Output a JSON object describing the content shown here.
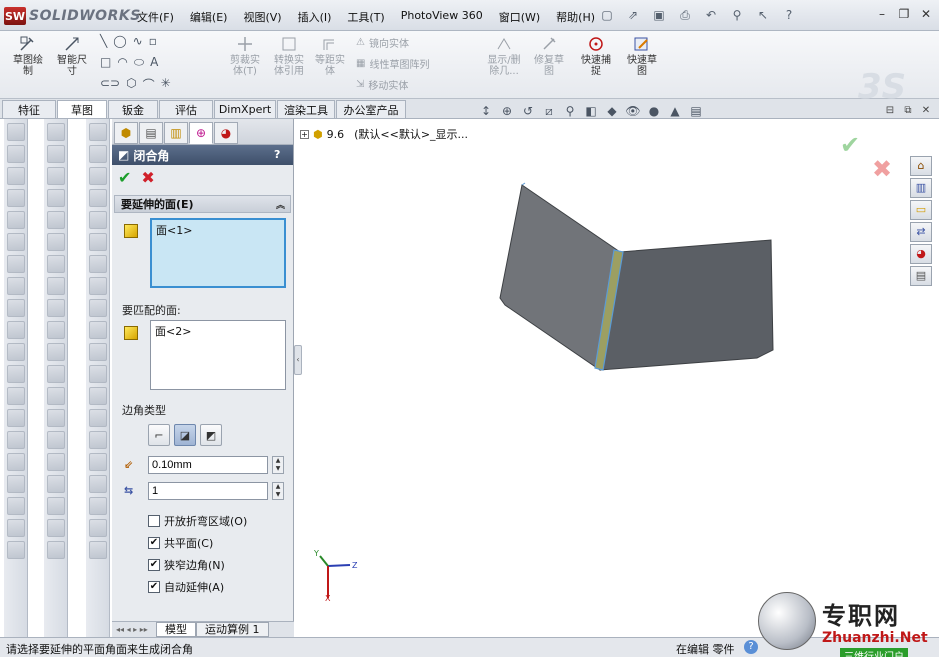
{
  "app": {
    "name": "SOLIDWORKS"
  },
  "menu": [
    "文件(F)",
    "编辑(E)",
    "视图(V)",
    "插入(I)",
    "工具(T)",
    "PhotoView 360",
    "窗口(W)",
    "帮助(H)"
  ],
  "commands": {
    "sketch_draw": "草图绘\n制",
    "smart_dim": "智能尺\n寸",
    "trim": "剪裁实\n体(T)",
    "convert": "转换实\n体引用",
    "offset": "等距实\n体",
    "mirror": "镜向实体",
    "linear_pattern": "线性草图阵列",
    "move": "移动实体",
    "show_delete": "显示/删\n除几...",
    "repair": "修复草\n图",
    "quick_snap": "快速捕\n捉",
    "rapid_sketch": "快速草\n图"
  },
  "cm_tabs": [
    "特征",
    "草图",
    "钣金",
    "评估",
    "DimXpert",
    "渲染工具",
    "办公室产品"
  ],
  "cm_active_tab": "草图",
  "feature_tree": {
    "root": "9.6",
    "config": "(默认<<默认>_显示..."
  },
  "pm": {
    "title": "闭合角",
    "help": "?",
    "group_title": "要延伸的面(E)",
    "face_to_extend": "面<1>",
    "faces_to_match_label": "要匹配的面:",
    "face_to_match": "面<2>",
    "corner_type_label": "边角类型",
    "gap_distance": "0.10mm",
    "overlap_ratio": "1",
    "options": [
      {
        "label": "开放折弯区域(O)",
        "checked": false
      },
      {
        "label": "共平面(C)",
        "checked": true
      },
      {
        "label": "狭窄边角(N)",
        "checked": true
      },
      {
        "label": "自动延伸(A)",
        "checked": true
      }
    ]
  },
  "bottom_tabs": [
    "模型",
    "运动算例 1"
  ],
  "status": {
    "message": "请选择要延伸的平面角面来生成闭合角",
    "editing": "在编辑  零件"
  },
  "watermark": {
    "zh": "专职网",
    "en": "Zhuanzhi.Net",
    "tag": "三维行业门户"
  },
  "colors": {
    "accent": "#3e4f6a",
    "ok": "#1b9e2b",
    "cancel": "#d0202a",
    "part_face": "#6f7379",
    "selection": "#c9e6f4"
  }
}
